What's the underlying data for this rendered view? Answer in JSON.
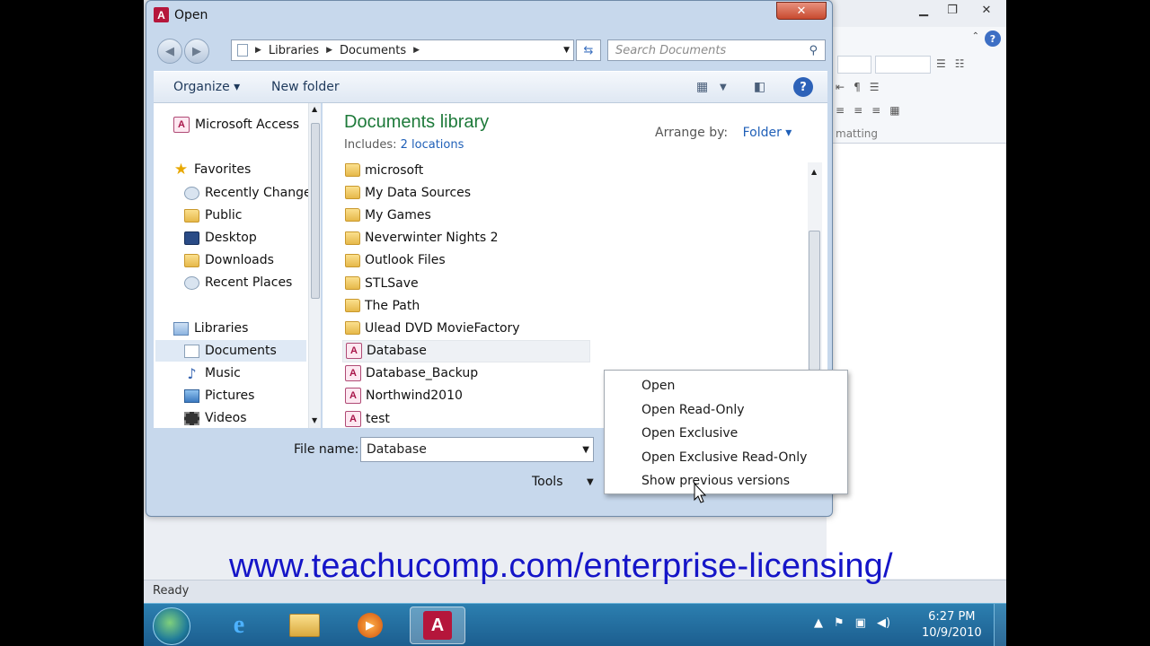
{
  "dialog": {
    "title": "Open",
    "app_badge": "A",
    "close_symbol": "✕",
    "address": {
      "segments": [
        "Libraries",
        "Documents"
      ]
    },
    "search_placeholder": "Search Documents",
    "toolbar": {
      "organize": "Organize ▾",
      "new_folder": "New folder",
      "help": "?"
    },
    "nav_pane": {
      "items": [
        {
          "label": "Microsoft Access",
          "icon": "access-icon"
        },
        {
          "label": "Favorites",
          "icon": "star-icon"
        },
        {
          "label": "Recently Changed",
          "icon": "recent-icon"
        },
        {
          "label": "Public",
          "icon": "folder-icon"
        },
        {
          "label": "Desktop",
          "icon": "desktop-icon"
        },
        {
          "label": "Downloads",
          "icon": "folder-icon"
        },
        {
          "label": "Recent Places",
          "icon": "recent-icon"
        },
        {
          "label": "Libraries",
          "icon": "library-icon"
        },
        {
          "label": "Documents",
          "icon": "document-icon"
        },
        {
          "label": "Music",
          "icon": "music-icon"
        },
        {
          "label": "Pictures",
          "icon": "pictures-icon"
        },
        {
          "label": "Videos",
          "icon": "video-icon"
        }
      ],
      "selected": "Documents"
    },
    "library": {
      "title": "Documents library",
      "includes_label": "Includes:",
      "includes_link": "2 locations",
      "arrange_label": "Arrange by:",
      "arrange_value": "Folder ▾"
    },
    "files": [
      {
        "name": "microsoft",
        "type": "folder"
      },
      {
        "name": "My Data Sources",
        "type": "datasource"
      },
      {
        "name": "My Games",
        "type": "folder"
      },
      {
        "name": "Neverwinter Nights 2",
        "type": "folder"
      },
      {
        "name": "Outlook Files",
        "type": "folder"
      },
      {
        "name": "STLSave",
        "type": "folder"
      },
      {
        "name": "The Path",
        "type": "folder"
      },
      {
        "name": "Ulead DVD MovieFactory",
        "type": "folder"
      },
      {
        "name": "Database",
        "type": "database"
      },
      {
        "name": "Database_Backup",
        "type": "database"
      },
      {
        "name": "Northwind2010",
        "type": "database"
      },
      {
        "name": "test",
        "type": "database"
      }
    ],
    "selected_file": "Database",
    "file_name_label": "File name:",
    "file_name_value": "Database",
    "tools_label": "Tools",
    "context_menu": [
      "Open",
      "Open Read-Only",
      "Open Exclusive",
      "Open Exclusive Read-Only",
      "Show previous versions"
    ]
  },
  "background_app": {
    "ribbon_group": "matting",
    "status": "Ready"
  },
  "watermark": "www.teachucomp.com/enterprise-licensing/",
  "taskbar": {
    "time": "6:27 PM",
    "date": "10/9/2010"
  }
}
